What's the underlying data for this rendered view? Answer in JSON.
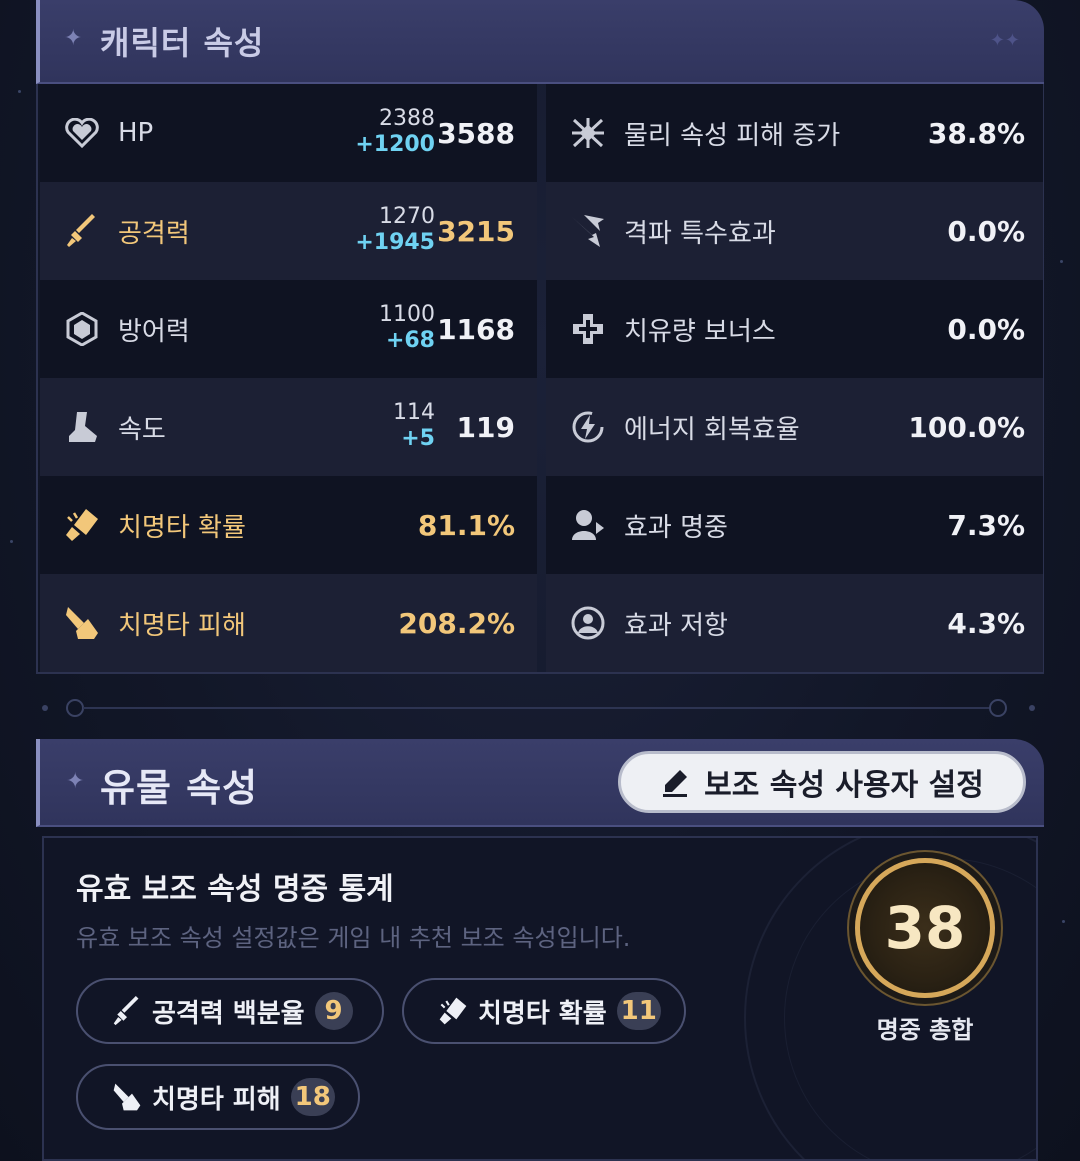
{
  "character_stats": {
    "title": "캐릭터 속성",
    "rows": [
      {
        "left": {
          "icon": "heart-icon",
          "label": "HP",
          "base": "2388",
          "bonus": "+1200",
          "total": "3588",
          "highlight": false
        },
        "right": {
          "icon": "physical-damage-icon",
          "label": "물리 속성 피해 증가",
          "value": "38.8%"
        }
      },
      {
        "left": {
          "icon": "sword-icon",
          "label": "공격력",
          "base": "1270",
          "bonus": "+1945",
          "total": "3215",
          "highlight": true
        },
        "right": {
          "icon": "break-effect-icon",
          "label": "격파 특수효과",
          "value": "0.0%"
        }
      },
      {
        "left": {
          "icon": "shield-icon",
          "label": "방어력",
          "base": "1100",
          "bonus": "+68",
          "total": "1168",
          "highlight": false
        },
        "right": {
          "icon": "healing-cross-icon",
          "label": "치유량 보너스",
          "value": "0.0%"
        }
      },
      {
        "left": {
          "icon": "boot-icon",
          "label": "속도",
          "base": "114",
          "bonus": "+5",
          "total": "119",
          "highlight": false
        },
        "right": {
          "icon": "energy-icon",
          "label": "에너지 회복효율",
          "value": "100.0%"
        }
      },
      {
        "left": {
          "icon": "crit-rate-icon",
          "label": "치명타 확률",
          "total": "81.1%",
          "highlight": true
        },
        "right": {
          "icon": "effect-hit-icon",
          "label": "효과 명중",
          "value": "7.3%"
        }
      },
      {
        "left": {
          "icon": "crit-damage-icon",
          "label": "치명타 피해",
          "total": "208.2%",
          "highlight": true
        },
        "right": {
          "icon": "effect-res-icon",
          "label": "효과 저항",
          "value": "4.3%"
        }
      }
    ]
  },
  "relic_stats": {
    "title": "유물 속성",
    "settings_button": "보조 속성 사용자 설정",
    "stats_title": "유효 보조 속성 명중 통계",
    "stats_subtitle": "유효 보조 속성 설정값은 게임 내 추천 보조 속성입니다.",
    "chips": [
      {
        "icon": "sword-icon",
        "label": "공격력 백분율",
        "count": "9"
      },
      {
        "icon": "crit-rate-icon",
        "label": "치명타 확률",
        "count": "11"
      },
      {
        "icon": "crit-damage-icon",
        "label": "치명타 피해",
        "count": "18"
      }
    ],
    "total_score": "38",
    "total_label": "명중 총합"
  },
  "colors": {
    "gold": "#f2c77a",
    "bonus_blue": "#6fd2f2",
    "header_bg": "#34385f"
  }
}
